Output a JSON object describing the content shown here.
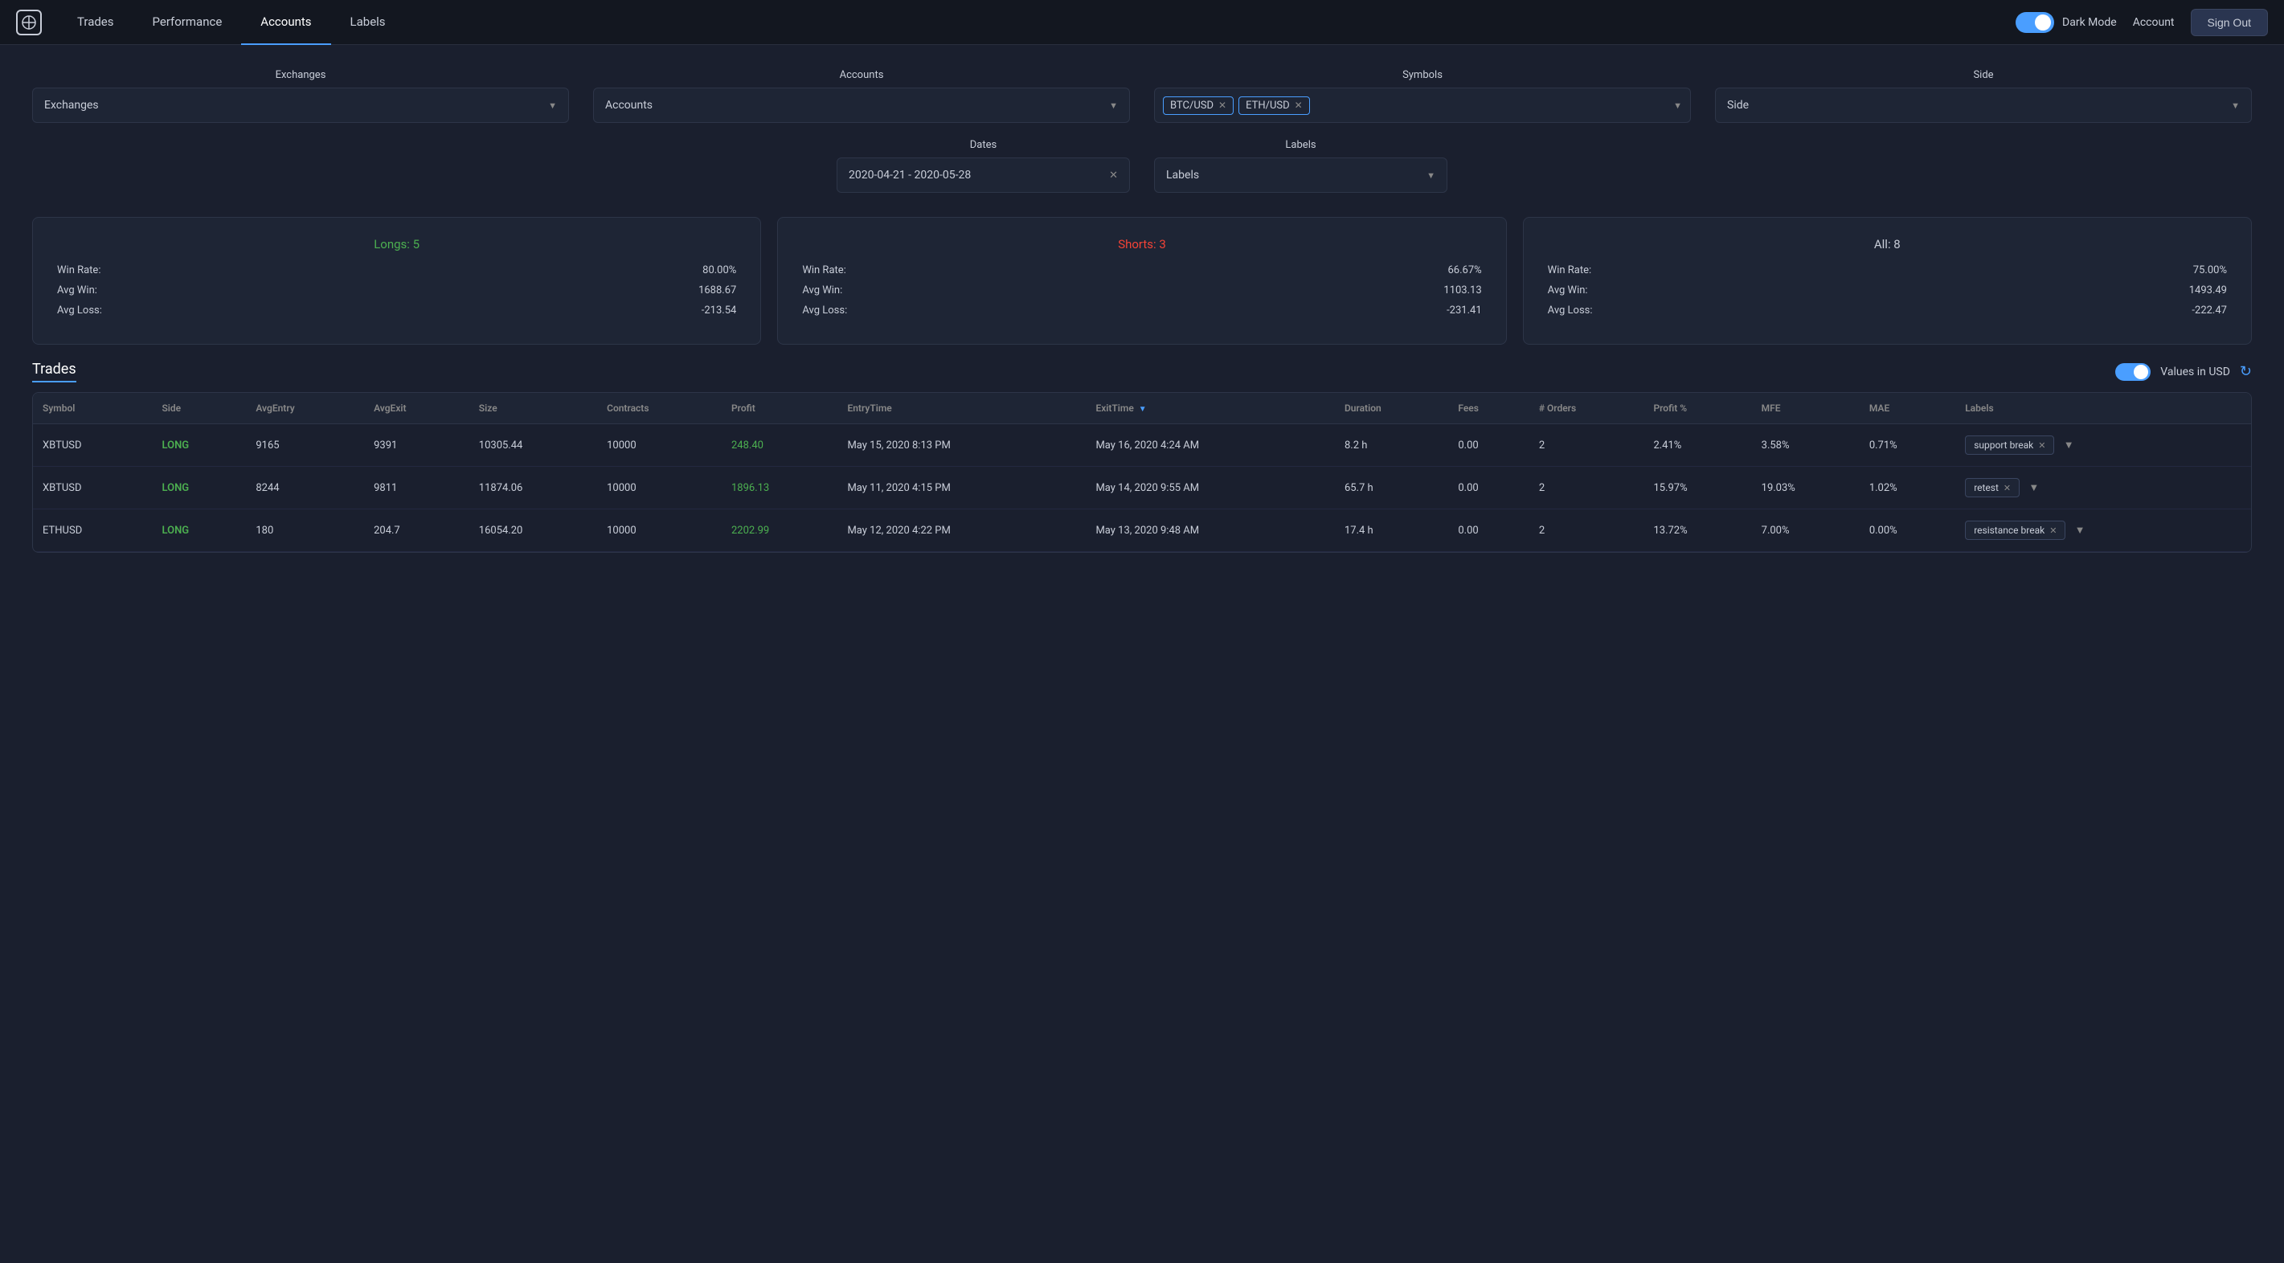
{
  "nav": {
    "logo_symbol": "⊕",
    "links": [
      {
        "label": "Trades",
        "active": false
      },
      {
        "label": "Performance",
        "active": false
      },
      {
        "label": "Accounts",
        "active": true
      },
      {
        "label": "Labels",
        "active": false
      }
    ],
    "dark_mode_label": "Dark Mode",
    "dark_mode_on": true,
    "account_label": "Account",
    "sign_out_label": "Sign Out"
  },
  "filters": {
    "exchanges_label": "Exchanges",
    "exchanges_placeholder": "Exchanges",
    "accounts_label": "Accounts",
    "accounts_placeholder": "Accounts",
    "symbols_label": "Symbols",
    "symbols_tags": [
      "BTC/USD",
      "ETH/USD"
    ],
    "side_label": "Side",
    "side_placeholder": "Side",
    "dates_label": "Dates",
    "dates_value": "2020-04-21 - 2020-05-28",
    "labels_label": "Labels",
    "labels_placeholder": "Labels"
  },
  "stats": {
    "longs": {
      "title": "Longs: 5",
      "win_rate_label": "Win Rate:",
      "win_rate_value": "80.00%",
      "avg_win_label": "Avg Win:",
      "avg_win_value": "1688.67",
      "avg_loss_label": "Avg Loss:",
      "avg_loss_value": "-213.54"
    },
    "shorts": {
      "title": "Shorts: 3",
      "win_rate_label": "Win Rate:",
      "win_rate_value": "66.67%",
      "avg_win_label": "Avg Win:",
      "avg_win_value": "1103.13",
      "avg_loss_label": "Avg Loss:",
      "avg_loss_value": "-231.41"
    },
    "all": {
      "title": "All: 8",
      "win_rate_label": "Win Rate:",
      "win_rate_value": "75.00%",
      "avg_win_label": "Avg Win:",
      "avg_win_value": "1493.49",
      "avg_loss_label": "Avg Loss:",
      "avg_loss_value": "-222.47"
    }
  },
  "trades_section": {
    "title": "Trades",
    "values_in_usd_label": "Values in USD",
    "columns": [
      "Symbol",
      "Side",
      "AvgEntry",
      "AvgExit",
      "Size",
      "Contracts",
      "Profit",
      "EntryTime",
      "ExitTime",
      "Duration",
      "Fees",
      "# Orders",
      "Profit %",
      "MFE",
      "MAE",
      "Labels"
    ],
    "rows": [
      {
        "symbol": "XBTUSD",
        "side": "LONG",
        "avg_entry": "9165",
        "avg_exit": "9391",
        "size": "10305.44",
        "contracts": "10000",
        "profit": "248.40",
        "profit_positive": true,
        "entry_time": "May 15, 2020 8:13 PM",
        "exit_time": "May 16, 2020 4:24 AM",
        "duration": "8.2 h",
        "fees": "0.00",
        "orders": "2",
        "profit_pct": "2.41%",
        "mfe": "3.58%",
        "mae": "0.71%",
        "label": "support break",
        "has_expand": true
      },
      {
        "symbol": "XBTUSD",
        "side": "LONG",
        "avg_entry": "8244",
        "avg_exit": "9811",
        "size": "11874.06",
        "contracts": "10000",
        "profit": "1896.13",
        "profit_positive": true,
        "entry_time": "May 11, 2020 4:15 PM",
        "exit_time": "May 14, 2020 9:55 AM",
        "duration": "65.7 h",
        "fees": "0.00",
        "orders": "2",
        "profit_pct": "15.97%",
        "mfe": "19.03%",
        "mae": "1.02%",
        "label": "retest",
        "has_expand": true
      },
      {
        "symbol": "ETHUSD",
        "side": "LONG",
        "avg_entry": "180",
        "avg_exit": "204.7",
        "size": "16054.20",
        "contracts": "10000",
        "profit": "2202.99",
        "profit_positive": true,
        "entry_time": "May 12, 2020 4:22 PM",
        "exit_time": "May 13, 2020 9:48 AM",
        "duration": "17.4 h",
        "fees": "0.00",
        "orders": "2",
        "profit_pct": "13.72%",
        "mfe": "7.00%",
        "mae": "0.00%",
        "label": "resistance break",
        "has_expand": true
      }
    ]
  }
}
